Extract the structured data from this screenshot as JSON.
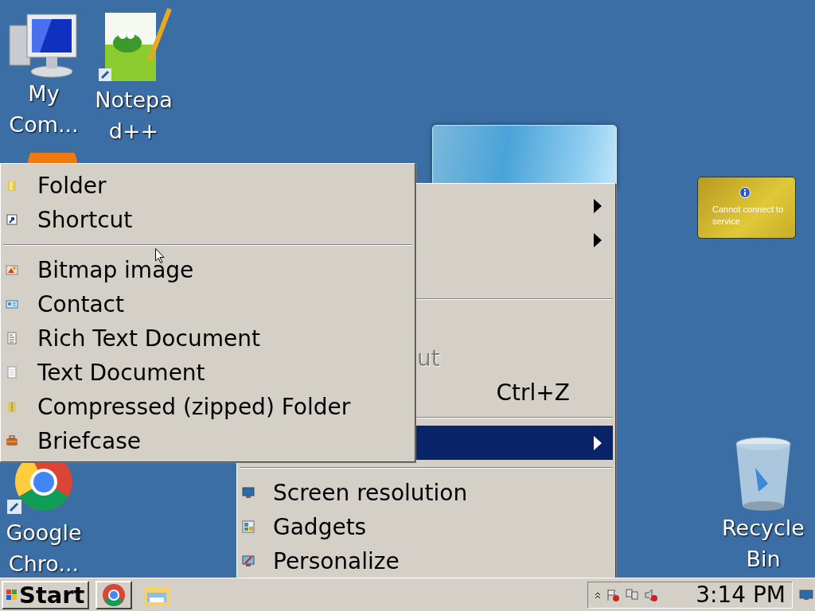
{
  "desktop_icons": [
    {
      "kind": "computer",
      "lines": [
        "My",
        "Com..."
      ]
    },
    {
      "kind": "notepad",
      "lines": [
        "Notepa",
        "d++"
      ]
    },
    {
      "kind": "chrome",
      "lines": [
        "Google",
        "Chro..."
      ]
    },
    {
      "kind": "recycle",
      "lines": [
        "Recycle",
        "Bin"
      ]
    }
  ],
  "gadget": {
    "message": "Cannot connect to service"
  },
  "context_menu": {
    "items": [
      {
        "kind": "submenu",
        "selected": false
      },
      {
        "kind": "submenu",
        "selected": false
      },
      {
        "kind": "item",
        "selected": false
      },
      {
        "kind": "separator"
      },
      {
        "kind": "item",
        "selected": false
      },
      {
        "kind": "clipped",
        "label": "ut",
        "selected": false,
        "disabled": true
      },
      {
        "kind": "item",
        "shortcut": "Ctrl+Z",
        "selected": false,
        "disabled": false
      },
      {
        "kind": "separator"
      },
      {
        "kind": "submenu",
        "selected": true
      },
      {
        "kind": "separator"
      },
      {
        "kind": "item",
        "label": "Screen resolution",
        "selected": false,
        "disabled": false
      },
      {
        "kind": "item",
        "label": "Gadgets",
        "selected": false,
        "disabled": false
      },
      {
        "kind": "item",
        "label": "Personalize",
        "selected": false,
        "disabled": false
      }
    ]
  },
  "new_submenu": {
    "items": [
      {
        "kind": "item",
        "label": "Folder",
        "selected": false
      },
      {
        "kind": "item",
        "label": "Shortcut",
        "selected": false
      },
      {
        "kind": "separator"
      },
      {
        "kind": "item",
        "label": "Bitmap image",
        "selected": false
      },
      {
        "kind": "item",
        "label": "Contact",
        "selected": false
      },
      {
        "kind": "item",
        "label": "Rich Text Document",
        "selected": false
      },
      {
        "kind": "item",
        "label": "Text Document",
        "selected": false
      },
      {
        "kind": "item",
        "label": "Compressed (zipped) Folder",
        "selected": false
      },
      {
        "kind": "item",
        "label": "Briefcase",
        "selected": false
      }
    ]
  },
  "taskbar": {
    "start_label": "Start",
    "clock": "3:14 PM"
  }
}
